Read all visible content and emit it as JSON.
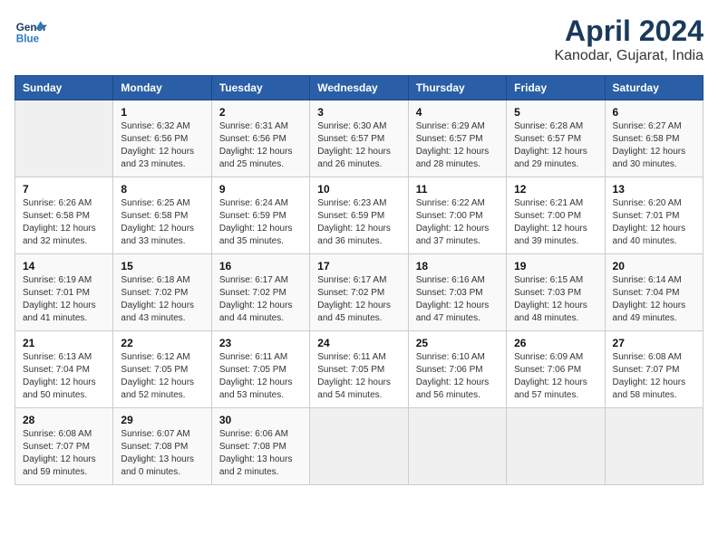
{
  "header": {
    "logo_line1": "General",
    "logo_line2": "Blue",
    "month": "April 2024",
    "location": "Kanodar, Gujarat, India"
  },
  "weekdays": [
    "Sunday",
    "Monday",
    "Tuesday",
    "Wednesday",
    "Thursday",
    "Friday",
    "Saturday"
  ],
  "weeks": [
    [
      {
        "day": "",
        "info": ""
      },
      {
        "day": "1",
        "info": "Sunrise: 6:32 AM\nSunset: 6:56 PM\nDaylight: 12 hours\nand 23 minutes."
      },
      {
        "day": "2",
        "info": "Sunrise: 6:31 AM\nSunset: 6:56 PM\nDaylight: 12 hours\nand 25 minutes."
      },
      {
        "day": "3",
        "info": "Sunrise: 6:30 AM\nSunset: 6:57 PM\nDaylight: 12 hours\nand 26 minutes."
      },
      {
        "day": "4",
        "info": "Sunrise: 6:29 AM\nSunset: 6:57 PM\nDaylight: 12 hours\nand 28 minutes."
      },
      {
        "day": "5",
        "info": "Sunrise: 6:28 AM\nSunset: 6:57 PM\nDaylight: 12 hours\nand 29 minutes."
      },
      {
        "day": "6",
        "info": "Sunrise: 6:27 AM\nSunset: 6:58 PM\nDaylight: 12 hours\nand 30 minutes."
      }
    ],
    [
      {
        "day": "7",
        "info": "Sunrise: 6:26 AM\nSunset: 6:58 PM\nDaylight: 12 hours\nand 32 minutes."
      },
      {
        "day": "8",
        "info": "Sunrise: 6:25 AM\nSunset: 6:58 PM\nDaylight: 12 hours\nand 33 minutes."
      },
      {
        "day": "9",
        "info": "Sunrise: 6:24 AM\nSunset: 6:59 PM\nDaylight: 12 hours\nand 35 minutes."
      },
      {
        "day": "10",
        "info": "Sunrise: 6:23 AM\nSunset: 6:59 PM\nDaylight: 12 hours\nand 36 minutes."
      },
      {
        "day": "11",
        "info": "Sunrise: 6:22 AM\nSunset: 7:00 PM\nDaylight: 12 hours\nand 37 minutes."
      },
      {
        "day": "12",
        "info": "Sunrise: 6:21 AM\nSunset: 7:00 PM\nDaylight: 12 hours\nand 39 minutes."
      },
      {
        "day": "13",
        "info": "Sunrise: 6:20 AM\nSunset: 7:01 PM\nDaylight: 12 hours\nand 40 minutes."
      }
    ],
    [
      {
        "day": "14",
        "info": "Sunrise: 6:19 AM\nSunset: 7:01 PM\nDaylight: 12 hours\nand 41 minutes."
      },
      {
        "day": "15",
        "info": "Sunrise: 6:18 AM\nSunset: 7:02 PM\nDaylight: 12 hours\nand 43 minutes."
      },
      {
        "day": "16",
        "info": "Sunrise: 6:17 AM\nSunset: 7:02 PM\nDaylight: 12 hours\nand 44 minutes."
      },
      {
        "day": "17",
        "info": "Sunrise: 6:17 AM\nSunset: 7:02 PM\nDaylight: 12 hours\nand 45 minutes."
      },
      {
        "day": "18",
        "info": "Sunrise: 6:16 AM\nSunset: 7:03 PM\nDaylight: 12 hours\nand 47 minutes."
      },
      {
        "day": "19",
        "info": "Sunrise: 6:15 AM\nSunset: 7:03 PM\nDaylight: 12 hours\nand 48 minutes."
      },
      {
        "day": "20",
        "info": "Sunrise: 6:14 AM\nSunset: 7:04 PM\nDaylight: 12 hours\nand 49 minutes."
      }
    ],
    [
      {
        "day": "21",
        "info": "Sunrise: 6:13 AM\nSunset: 7:04 PM\nDaylight: 12 hours\nand 50 minutes."
      },
      {
        "day": "22",
        "info": "Sunrise: 6:12 AM\nSunset: 7:05 PM\nDaylight: 12 hours\nand 52 minutes."
      },
      {
        "day": "23",
        "info": "Sunrise: 6:11 AM\nSunset: 7:05 PM\nDaylight: 12 hours\nand 53 minutes."
      },
      {
        "day": "24",
        "info": "Sunrise: 6:11 AM\nSunset: 7:05 PM\nDaylight: 12 hours\nand 54 minutes."
      },
      {
        "day": "25",
        "info": "Sunrise: 6:10 AM\nSunset: 7:06 PM\nDaylight: 12 hours\nand 56 minutes."
      },
      {
        "day": "26",
        "info": "Sunrise: 6:09 AM\nSunset: 7:06 PM\nDaylight: 12 hours\nand 57 minutes."
      },
      {
        "day": "27",
        "info": "Sunrise: 6:08 AM\nSunset: 7:07 PM\nDaylight: 12 hours\nand 58 minutes."
      }
    ],
    [
      {
        "day": "28",
        "info": "Sunrise: 6:08 AM\nSunset: 7:07 PM\nDaylight: 12 hours\nand 59 minutes."
      },
      {
        "day": "29",
        "info": "Sunrise: 6:07 AM\nSunset: 7:08 PM\nDaylight: 13 hours\nand 0 minutes."
      },
      {
        "day": "30",
        "info": "Sunrise: 6:06 AM\nSunset: 7:08 PM\nDaylight: 13 hours\nand 2 minutes."
      },
      {
        "day": "",
        "info": ""
      },
      {
        "day": "",
        "info": ""
      },
      {
        "day": "",
        "info": ""
      },
      {
        "day": "",
        "info": ""
      }
    ]
  ]
}
